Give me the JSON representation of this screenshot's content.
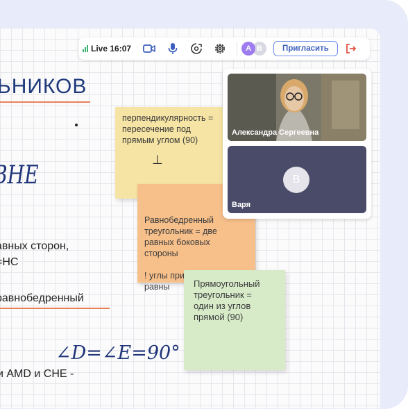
{
  "board": {
    "title_fragment": "ЬНИКОВ",
    "avne_fragment": "ВНЕ",
    "line1": ")",
    "line2": "авных сторон,",
    "line3": "=НС",
    "line4": "равнобедренный",
    "angles": "∠D=∠E=90°",
    "line5": "и AMD и CHE -"
  },
  "stickies": [
    {
      "lines": [
        "перпендикулярность =",
        "пересечение под",
        "прямым углом (90)"
      ],
      "symbol": "⊥",
      "color": "#f6e4a4"
    },
    {
      "lines": [
        "Равнобедренный",
        "треугольник = две",
        "равных боковых",
        "стороны",
        "",
        "! углы при основании",
        "равны"
      ],
      "color": "#f7c08b"
    },
    {
      "lines": [
        "Прямоугольный",
        "треугольник =",
        "один из углов",
        "прямой (90)"
      ],
      "color": "#d7ebc9"
    }
  ],
  "toolbar": {
    "live_label": "Live 16:07",
    "camera_icon": "camera-icon",
    "mic_icon": "microphone-icon",
    "share_icon": "screen-share-icon",
    "settings_icon": "gear-icon",
    "avatar_a": "А",
    "avatar_b": "В",
    "invite_label": "Пригласить",
    "exit_icon": "exit-icon",
    "accent": "#6b8de8",
    "danger": "#e05545"
  },
  "video": {
    "tile1_name": "Александра Сергеевна",
    "tile2_name": "Варя",
    "tile2_initial": "В"
  }
}
